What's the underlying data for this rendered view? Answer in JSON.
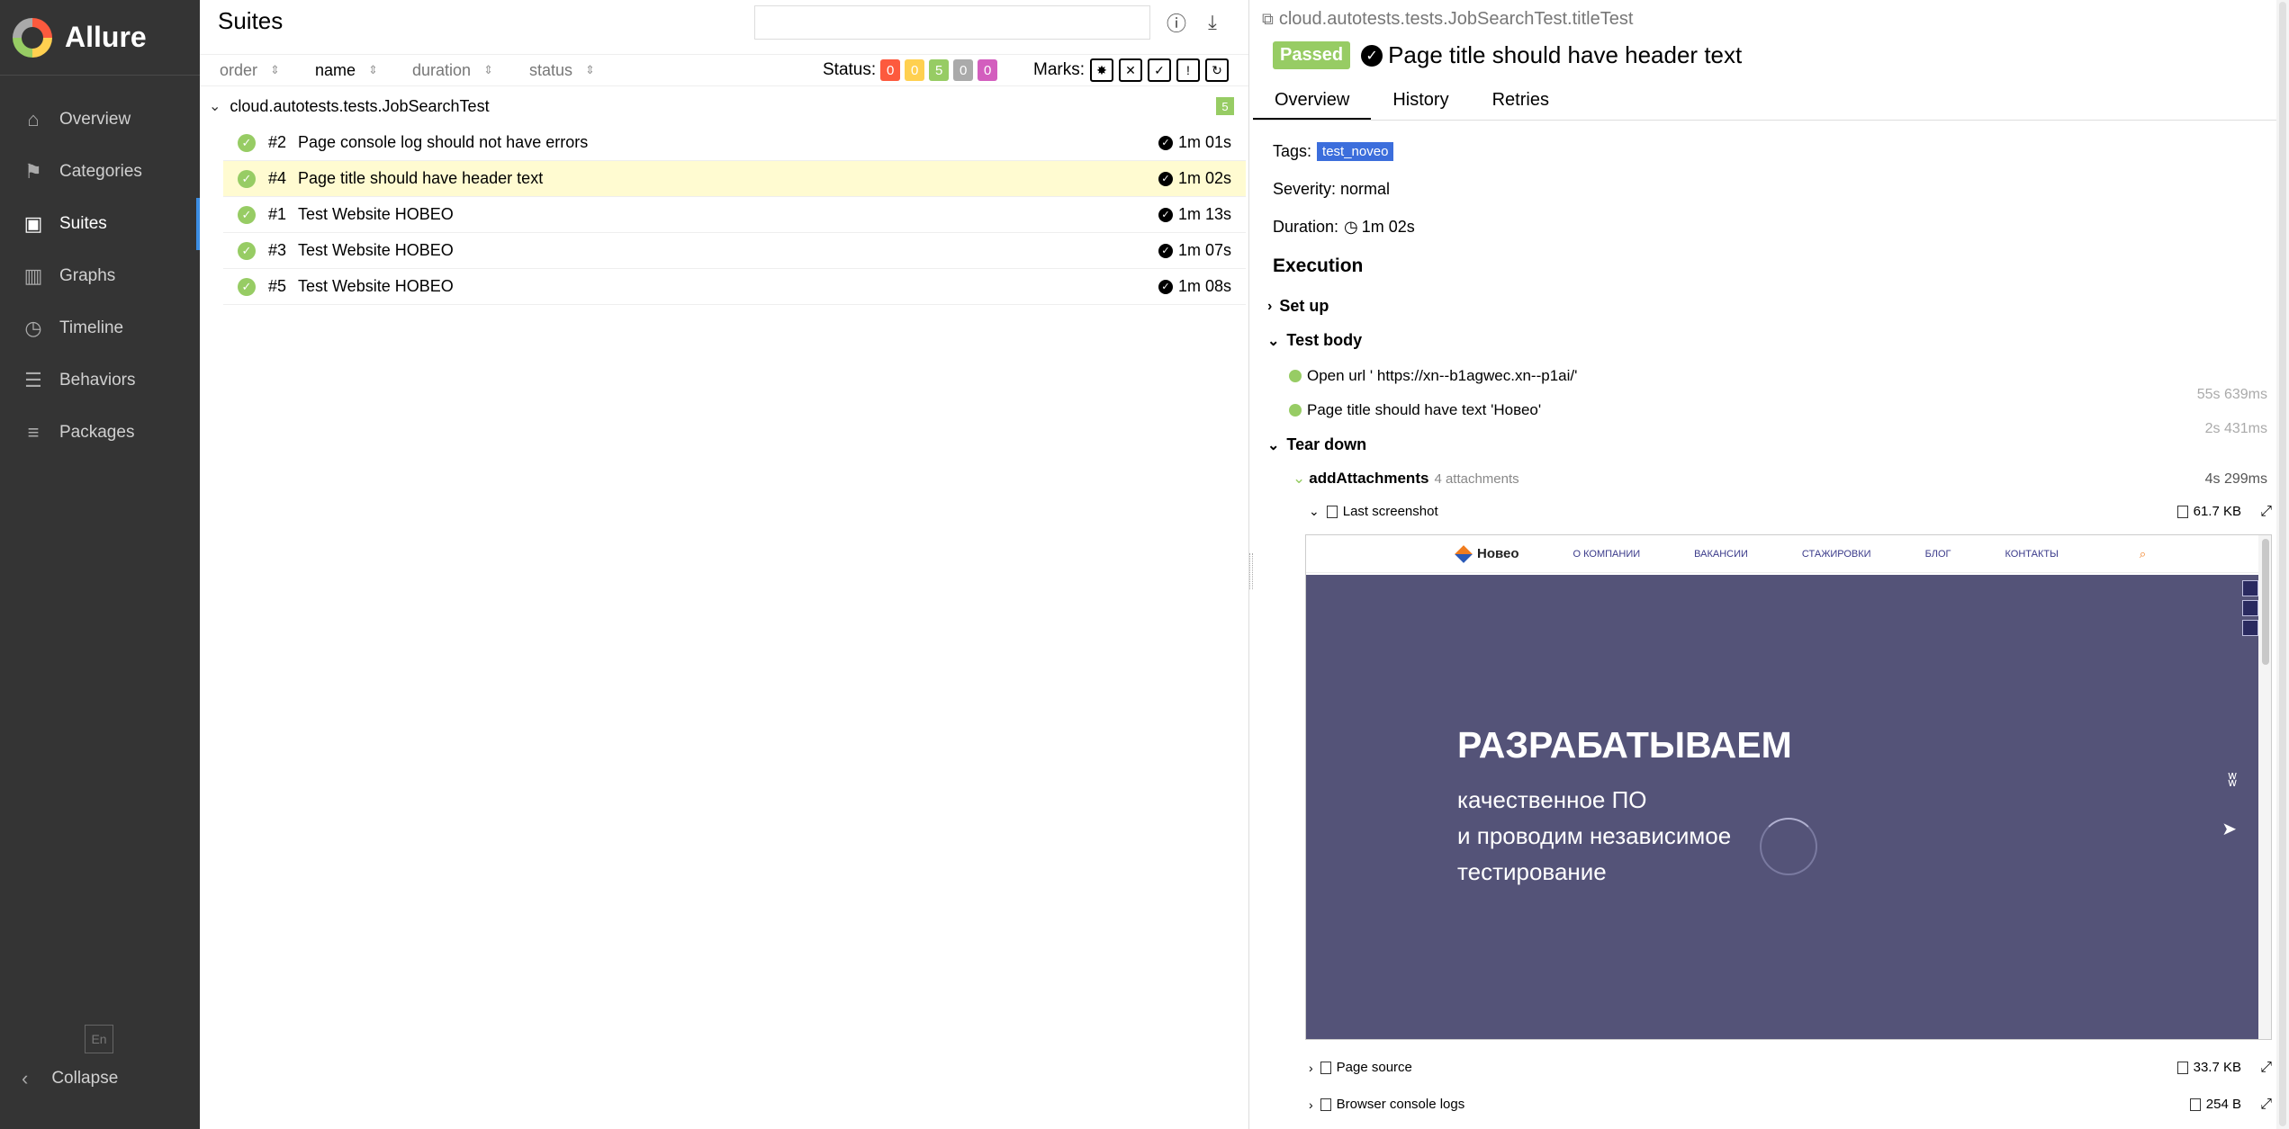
{
  "app": {
    "name": "Allure"
  },
  "sidebar": {
    "items": [
      {
        "label": "Overview",
        "icon": "home-icon"
      },
      {
        "label": "Categories",
        "icon": "flag-icon"
      },
      {
        "label": "Suites",
        "icon": "briefcase-icon"
      },
      {
        "label": "Graphs",
        "icon": "bar-chart-icon"
      },
      {
        "label": "Timeline",
        "icon": "clock-icon"
      },
      {
        "label": "Behaviors",
        "icon": "list-icon"
      },
      {
        "label": "Packages",
        "icon": "align-left-icon"
      }
    ],
    "active": "Suites",
    "language": "En",
    "collapse_label": "Collapse"
  },
  "suites_pane": {
    "title": "Suites",
    "sort": {
      "order": "order",
      "name": "name",
      "duration": "duration",
      "status": "status"
    },
    "status_label": "Status:",
    "status_counts": [
      {
        "value": "0",
        "color": "#fd5a3e"
      },
      {
        "value": "0",
        "color": "#ffd050"
      },
      {
        "value": "5",
        "color": "#97cc64"
      },
      {
        "value": "0",
        "color": "#aaaaaa"
      },
      {
        "value": "0",
        "color": "#d35ebe"
      }
    ],
    "marks_label": "Marks:",
    "suite": {
      "name": "cloud.autotests.tests.JobSearchTest",
      "count": "5"
    },
    "tests": [
      {
        "num": "#2",
        "name": "Page console log should not have errors",
        "duration": "1m 01s"
      },
      {
        "num": "#4",
        "name": "Page title should have header text",
        "duration": "1m 02s",
        "selected": true
      },
      {
        "num": "#1",
        "name": "Test Website НОВЕО",
        "duration": "1m 13s"
      },
      {
        "num": "#3",
        "name": "Test Website НОВЕО",
        "duration": "1m 07s"
      },
      {
        "num": "#5",
        "name": "Test Website НОВЕО",
        "duration": "1m 08s"
      }
    ]
  },
  "detail": {
    "breadcrumb": "cloud.autotests.tests.JobSearchTest.titleTest",
    "status": "Passed",
    "title": "Page title should have header text",
    "tabs": [
      "Overview",
      "History",
      "Retries"
    ],
    "tags_label": "Tags:",
    "tag": "test_noveo",
    "severity": "Severity: normal",
    "duration_label": "Duration:",
    "duration": "1m 02s",
    "execution_title": "Execution",
    "setup": "Set up",
    "test_body": "Test body",
    "steps": [
      {
        "label": "Open url ' https://xn--b1agwec.xn--p1ai/'",
        "time": "55s 639ms"
      },
      {
        "label": "Page title should have text 'Новео'",
        "time": "2s 431ms"
      }
    ],
    "teardown": "Tear down",
    "add_attachments": {
      "label": "addAttachments",
      "count": "4 attachments",
      "time": "4s 299ms"
    },
    "attachments": [
      {
        "name": "Last screenshot",
        "size": "61.7 KB"
      },
      {
        "name": "Page source",
        "size": "33.7 KB"
      },
      {
        "name": "Browser console logs",
        "size": "254 B"
      }
    ],
    "screenshot": {
      "logo": "Новео",
      "nav": [
        "О КОМПАНИИ",
        "ВАКАНСИИ",
        "СТАЖИРОВКИ",
        "БЛОГ",
        "КОНТАКТЫ"
      ],
      "headline": "РАЗРАБАТЫВАЕМ",
      "lines": [
        "качественное ПО",
        "и проводим независимое",
        "тестирование"
      ],
      "hero_color": "#545378"
    }
  }
}
